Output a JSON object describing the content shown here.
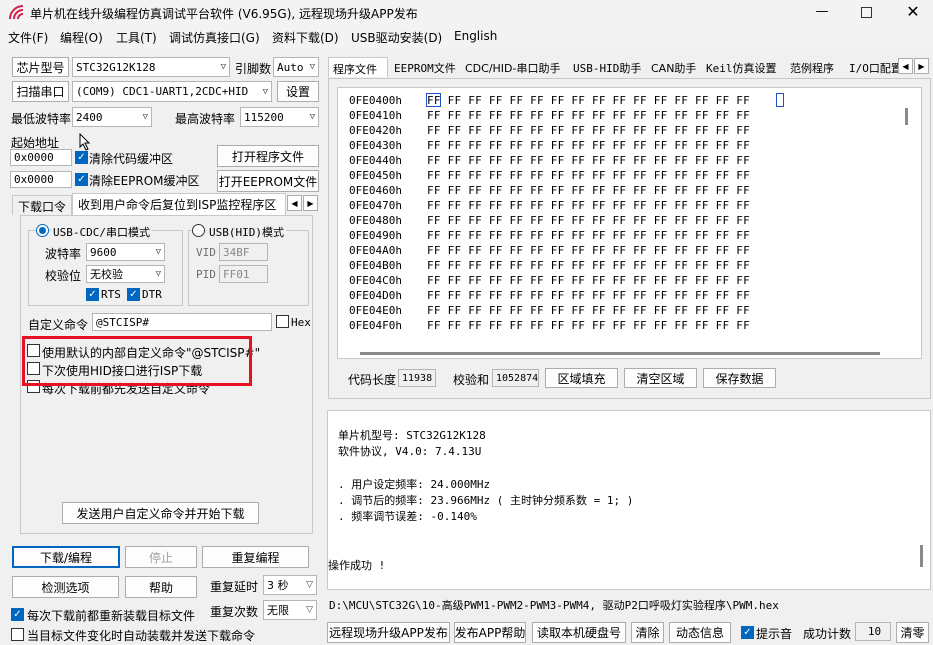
{
  "title": "单片机在线升级编程仿真调试平台软件 (V6.95G), 远程现场升级APP发布",
  "menu": [
    "文件(F)",
    "编程(O)",
    "工具(T)",
    "调试仿真接口(G)",
    "资料下载(D)",
    "USB驱动安装(D)",
    "English"
  ],
  "left": {
    "chip_label": "芯片型号",
    "chip_value": "STC32G12K128",
    "pin_label": "引脚数",
    "pin_value": "Auto",
    "scan_label": "扫描串口",
    "port_value": "(COM9) CDC1-UART1,2CDC+HID",
    "settings_label": "设置",
    "min_baud_label": "最低波特率",
    "min_baud_value": "2400",
    "max_baud_label": "最高波特率",
    "max_baud_value": "115200",
    "start_addr_label": "起始地址",
    "addr1": "0x0000",
    "clear_code_label": "清除代码缓冲区",
    "open_prog_label": "打开程序文件",
    "addr2": "0x0000",
    "clear_eeprom_label": "清除EEPROM缓冲区",
    "open_eeprom_label": "打开EEPROM文件",
    "subtab1": "下载口令",
    "subtab2": "收到用户命令后复位到ISP监控程序区",
    "usb_cdc_label": "USB-CDC/串口模式",
    "usb_hid_label": "USB(HID)模式",
    "baud_label": "波特率",
    "baud_value": "9600",
    "parity_label": "校验位",
    "parity_value": "无校验",
    "rts_label": "RTS",
    "dtr_label": "DTR",
    "vid_label": "VID",
    "vid_value": "34BF",
    "pid_label": "PID",
    "pid_value": "FF01",
    "custom_cmd_label": "自定义命令",
    "custom_cmd_value": "@STCISP#",
    "hex_label": "Hex",
    "opt1": "使用默认的内部自定义命令\"@STCISP#\"",
    "opt2": "下次使用HID接口进行ISP下载",
    "opt3": "每次下载前都先发送自定义命令",
    "send_button": "发送用户自定义命令并开始下载",
    "download_label": "下载/编程",
    "stop_label": "停止",
    "reprogram_label": "重复编程",
    "check_label": "检测选项",
    "help_label": "帮助",
    "repeat_delay_label": "重复延时",
    "repeat_delay_value": "3 秒",
    "reload_label": "每次下载前都重新装载目标文件",
    "repeat_count_label": "重复次数",
    "repeat_count_value": "无限",
    "auto_label": "当目标文件变化时自动装载并发送下载命令"
  },
  "right": {
    "tabs": [
      "程序文件",
      "EEPROM文件",
      "CDC/HID-串口助手",
      "USB-HID助手",
      "CAN助手",
      "Keil仿真设置",
      "范例程序",
      "I/O口配置"
    ],
    "hex_rows": [
      {
        "addr": "0FE0400h",
        "data": "FF FF FF FF FF FF FF FF FF FF FF FF FF FF FF FF"
      },
      {
        "addr": "0FE0410h",
        "data": "FF FF FF FF FF FF FF FF FF FF FF FF FF FF FF FF"
      },
      {
        "addr": "0FE0420h",
        "data": "FF FF FF FF FF FF FF FF FF FF FF FF FF FF FF FF"
      },
      {
        "addr": "0FE0430h",
        "data": "FF FF FF FF FF FF FF FF FF FF FF FF FF FF FF FF"
      },
      {
        "addr": "0FE0440h",
        "data": "FF FF FF FF FF FF FF FF FF FF FF FF FF FF FF FF"
      },
      {
        "addr": "0FE0450h",
        "data": "FF FF FF FF FF FF FF FF FF FF FF FF FF FF FF FF"
      },
      {
        "addr": "0FE0460h",
        "data": "FF FF FF FF FF FF FF FF FF FF FF FF FF FF FF FF"
      },
      {
        "addr": "0FE0470h",
        "data": "FF FF FF FF FF FF FF FF FF FF FF FF FF FF FF FF"
      },
      {
        "addr": "0FE0480h",
        "data": "FF FF FF FF FF FF FF FF FF FF FF FF FF FF FF FF"
      },
      {
        "addr": "0FE0490h",
        "data": "FF FF FF FF FF FF FF FF FF FF FF FF FF FF FF FF"
      },
      {
        "addr": "0FE04A0h",
        "data": "FF FF FF FF FF FF FF FF FF FF FF FF FF FF FF FF"
      },
      {
        "addr": "0FE04B0h",
        "data": "FF FF FF FF FF FF FF FF FF FF FF FF FF FF FF FF"
      },
      {
        "addr": "0FE04C0h",
        "data": "FF FF FF FF FF FF FF FF FF FF FF FF FF FF FF FF"
      },
      {
        "addr": "0FE04D0h",
        "data": "FF FF FF FF FF FF FF FF FF FF FF FF FF FF FF FF"
      },
      {
        "addr": "0FE04E0h",
        "data": "FF FF FF FF FF FF FF FF FF FF FF FF FF FF FF FF"
      },
      {
        "addr": "0FE04F0h",
        "data": "FF FF FF FF FF FF FF FF FF FF FF FF FF FF FF FF"
      }
    ],
    "code_len_label": "代码长度",
    "code_len_value": "11938",
    "checksum_label": "校验和",
    "checksum_value": "1052874",
    "fill_label": "区域填充",
    "clear_area_label": "清空区域",
    "save_label": "保存数据",
    "log": [
      "单片机型号: STC32G12K128",
      "软件协议, V4.0: 7.4.13U",
      "",
      ". 用户设定频率: 24.000MHz",
      ". 调节后的频率: 23.966MHz ( 主时钟分频系数 = 1; )",
      ". 频率调节误差: -0.140%",
      "",
      "",
      "操作成功 !"
    ],
    "path": "D:\\MCU\\STC32G\\10-高级PWM1-PWM2-PWM3-PWM4, 驱动P2口呼吸灯实验程序\\PWM.hex",
    "bottom_buttons": [
      "远程现场升级APP发布",
      "发布APP帮助",
      "读取本机硬盘号",
      "清除",
      "动态信息"
    ],
    "beep_label": "提示音",
    "success_label": "成功计数",
    "success_value": "10",
    "clear_count_label": "清零"
  },
  "colors": {
    "highlight": "#e81123",
    "accent": "#0067c0"
  }
}
